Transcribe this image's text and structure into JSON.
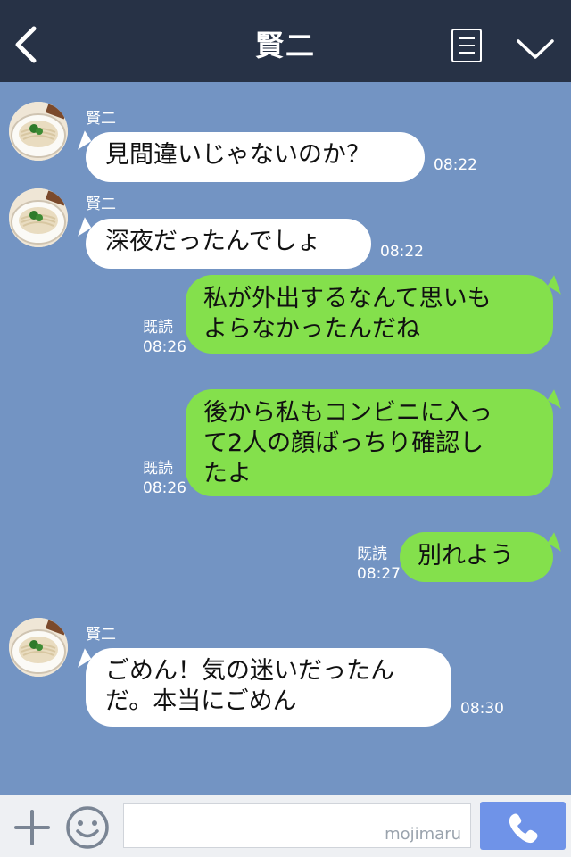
{
  "header": {
    "title": "賢二",
    "back_icon": "chevron-left-icon",
    "menu_icon": "menu-icon",
    "collapse_icon": "chevron-down-icon"
  },
  "colors": {
    "header_bg": "#273246",
    "chat_bg": "#7394c3",
    "incoming_bubble": "#ffffff",
    "outgoing_bubble": "#84e04c",
    "call_button": "#6f93e8"
  },
  "messages": [
    {
      "sender": "賢二",
      "text": "見間違いじゃないのか？",
      "time": "08:22"
    },
    {
      "sender": "賢二",
      "text": "深夜だったんでしょ",
      "time": "08:22"
    },
    {
      "text": "私が外出するなんて思いも\nよらなかったんだね",
      "read": "既読",
      "time": "08:26"
    },
    {
      "text": "後から私もコンビニに入っ\nて2人の顔ばっちり確認し\nたよ",
      "read": "既読",
      "time": "08:26"
    },
    {
      "text": "別れよう",
      "read": "既読",
      "time": "08:27"
    },
    {
      "sender": "賢二",
      "text": "ごめん！気の迷いだったん\nだ。本当にごめん",
      "time": "08:30"
    }
  ],
  "input_bar": {
    "plus_icon": "plus-icon",
    "emoji_icon": "smiley-icon",
    "input_value": "",
    "watermark": "mojimaru",
    "call_icon": "phone-icon"
  }
}
